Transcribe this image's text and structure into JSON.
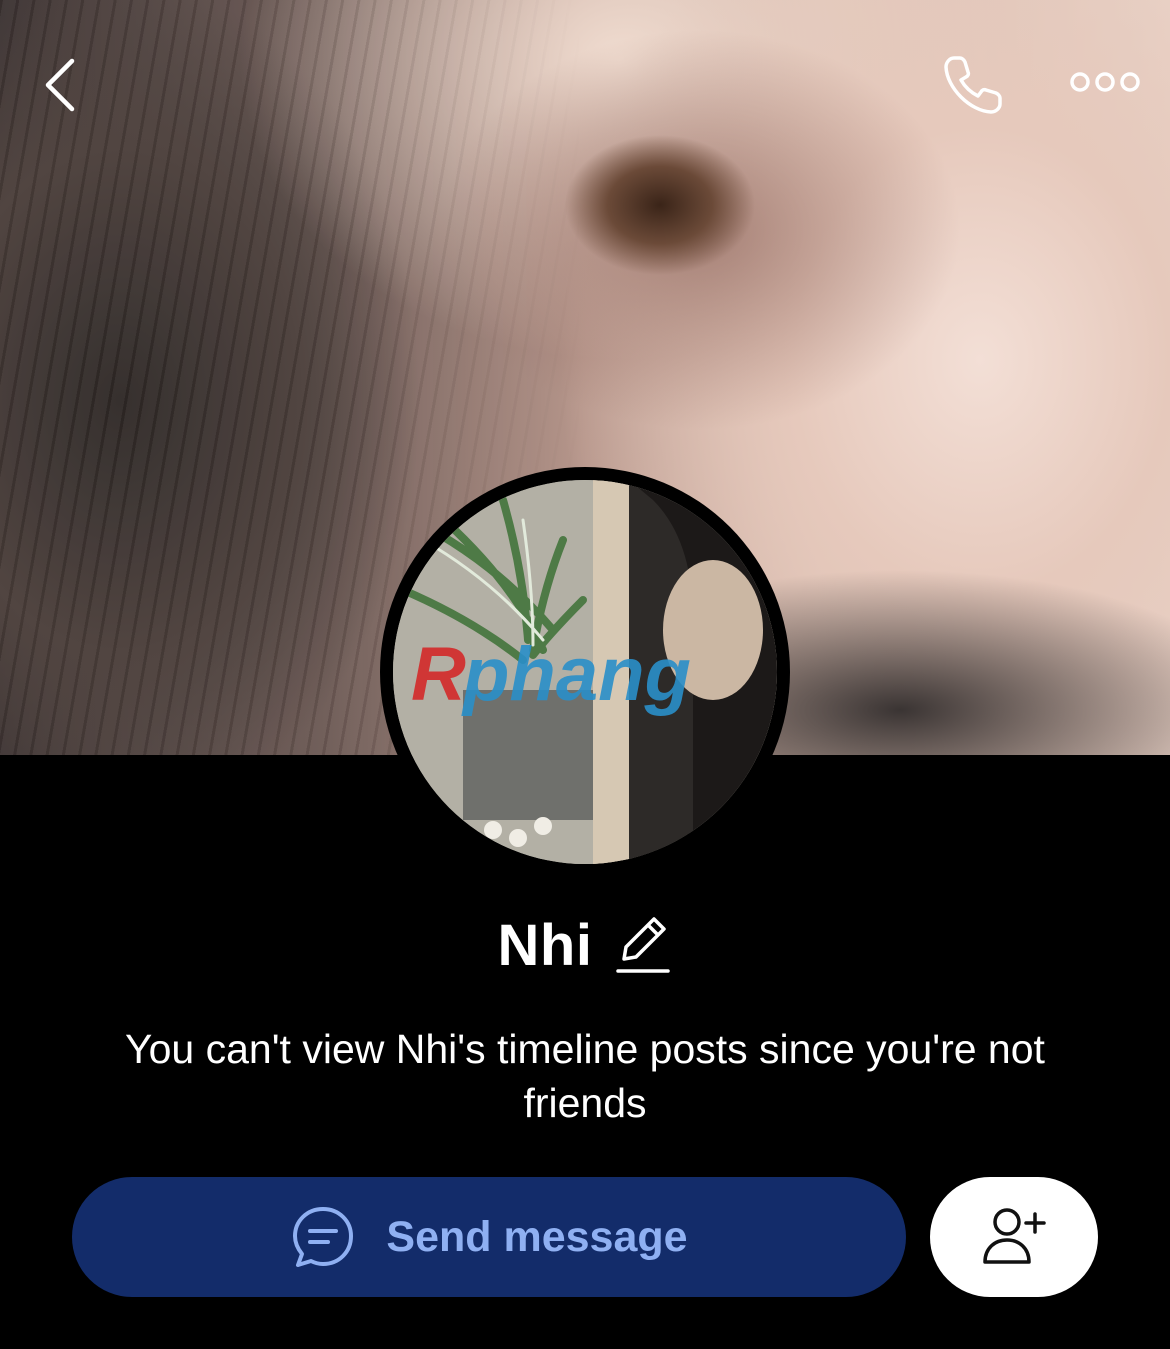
{
  "profile": {
    "name": "Nhi",
    "cover_photo_icon": "cover-photo",
    "avatar_icon": "profile-photo",
    "avatar_watermark": "Rphang"
  },
  "header": {
    "back_icon": "chevron-left-icon",
    "call_icon": "phone-icon",
    "more_icon": "more-options-icon"
  },
  "notice": {
    "text": "You can't view Nhi's timeline posts since you're not friends"
  },
  "actions": {
    "send_message_label": "Send message",
    "send_message_icon": "chat-bubble-icon",
    "add_friend_icon": "add-friend-icon"
  },
  "colors": {
    "background": "#000000",
    "send_button_bg": "#132c6a",
    "send_button_text": "#8fb0f2",
    "add_button_bg": "#ffffff",
    "text": "#ffffff"
  }
}
